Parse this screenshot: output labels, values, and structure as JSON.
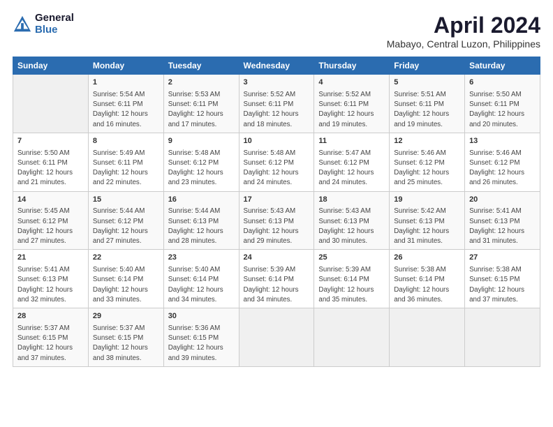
{
  "logo": {
    "general": "General",
    "blue": "Blue"
  },
  "title": "April 2024",
  "subtitle": "Mabayo, Central Luzon, Philippines",
  "columns": [
    "Sunday",
    "Monday",
    "Tuesday",
    "Wednesday",
    "Thursday",
    "Friday",
    "Saturday"
  ],
  "rows": [
    [
      {
        "day": "",
        "info": ""
      },
      {
        "day": "1",
        "info": "Sunrise: 5:54 AM\nSunset: 6:11 PM\nDaylight: 12 hours\nand 16 minutes."
      },
      {
        "day": "2",
        "info": "Sunrise: 5:53 AM\nSunset: 6:11 PM\nDaylight: 12 hours\nand 17 minutes."
      },
      {
        "day": "3",
        "info": "Sunrise: 5:52 AM\nSunset: 6:11 PM\nDaylight: 12 hours\nand 18 minutes."
      },
      {
        "day": "4",
        "info": "Sunrise: 5:52 AM\nSunset: 6:11 PM\nDaylight: 12 hours\nand 19 minutes."
      },
      {
        "day": "5",
        "info": "Sunrise: 5:51 AM\nSunset: 6:11 PM\nDaylight: 12 hours\nand 19 minutes."
      },
      {
        "day": "6",
        "info": "Sunrise: 5:50 AM\nSunset: 6:11 PM\nDaylight: 12 hours\nand 20 minutes."
      }
    ],
    [
      {
        "day": "7",
        "info": "Sunrise: 5:50 AM\nSunset: 6:11 PM\nDaylight: 12 hours\nand 21 minutes."
      },
      {
        "day": "8",
        "info": "Sunrise: 5:49 AM\nSunset: 6:11 PM\nDaylight: 12 hours\nand 22 minutes."
      },
      {
        "day": "9",
        "info": "Sunrise: 5:48 AM\nSunset: 6:12 PM\nDaylight: 12 hours\nand 23 minutes."
      },
      {
        "day": "10",
        "info": "Sunrise: 5:48 AM\nSunset: 6:12 PM\nDaylight: 12 hours\nand 24 minutes."
      },
      {
        "day": "11",
        "info": "Sunrise: 5:47 AM\nSunset: 6:12 PM\nDaylight: 12 hours\nand 24 minutes."
      },
      {
        "day": "12",
        "info": "Sunrise: 5:46 AM\nSunset: 6:12 PM\nDaylight: 12 hours\nand 25 minutes."
      },
      {
        "day": "13",
        "info": "Sunrise: 5:46 AM\nSunset: 6:12 PM\nDaylight: 12 hours\nand 26 minutes."
      }
    ],
    [
      {
        "day": "14",
        "info": "Sunrise: 5:45 AM\nSunset: 6:12 PM\nDaylight: 12 hours\nand 27 minutes."
      },
      {
        "day": "15",
        "info": "Sunrise: 5:44 AM\nSunset: 6:12 PM\nDaylight: 12 hours\nand 27 minutes."
      },
      {
        "day": "16",
        "info": "Sunrise: 5:44 AM\nSunset: 6:13 PM\nDaylight: 12 hours\nand 28 minutes."
      },
      {
        "day": "17",
        "info": "Sunrise: 5:43 AM\nSunset: 6:13 PM\nDaylight: 12 hours\nand 29 minutes."
      },
      {
        "day": "18",
        "info": "Sunrise: 5:43 AM\nSunset: 6:13 PM\nDaylight: 12 hours\nand 30 minutes."
      },
      {
        "day": "19",
        "info": "Sunrise: 5:42 AM\nSunset: 6:13 PM\nDaylight: 12 hours\nand 31 minutes."
      },
      {
        "day": "20",
        "info": "Sunrise: 5:41 AM\nSunset: 6:13 PM\nDaylight: 12 hours\nand 31 minutes."
      }
    ],
    [
      {
        "day": "21",
        "info": "Sunrise: 5:41 AM\nSunset: 6:13 PM\nDaylight: 12 hours\nand 32 minutes."
      },
      {
        "day": "22",
        "info": "Sunrise: 5:40 AM\nSunset: 6:14 PM\nDaylight: 12 hours\nand 33 minutes."
      },
      {
        "day": "23",
        "info": "Sunrise: 5:40 AM\nSunset: 6:14 PM\nDaylight: 12 hours\nand 34 minutes."
      },
      {
        "day": "24",
        "info": "Sunrise: 5:39 AM\nSunset: 6:14 PM\nDaylight: 12 hours\nand 34 minutes."
      },
      {
        "day": "25",
        "info": "Sunrise: 5:39 AM\nSunset: 6:14 PM\nDaylight: 12 hours\nand 35 minutes."
      },
      {
        "day": "26",
        "info": "Sunrise: 5:38 AM\nSunset: 6:14 PM\nDaylight: 12 hours\nand 36 minutes."
      },
      {
        "day": "27",
        "info": "Sunrise: 5:38 AM\nSunset: 6:15 PM\nDaylight: 12 hours\nand 37 minutes."
      }
    ],
    [
      {
        "day": "28",
        "info": "Sunrise: 5:37 AM\nSunset: 6:15 PM\nDaylight: 12 hours\nand 37 minutes."
      },
      {
        "day": "29",
        "info": "Sunrise: 5:37 AM\nSunset: 6:15 PM\nDaylight: 12 hours\nand 38 minutes."
      },
      {
        "day": "30",
        "info": "Sunrise: 5:36 AM\nSunset: 6:15 PM\nDaylight: 12 hours\nand 39 minutes."
      },
      {
        "day": "",
        "info": ""
      },
      {
        "day": "",
        "info": ""
      },
      {
        "day": "",
        "info": ""
      },
      {
        "day": "",
        "info": ""
      }
    ]
  ]
}
